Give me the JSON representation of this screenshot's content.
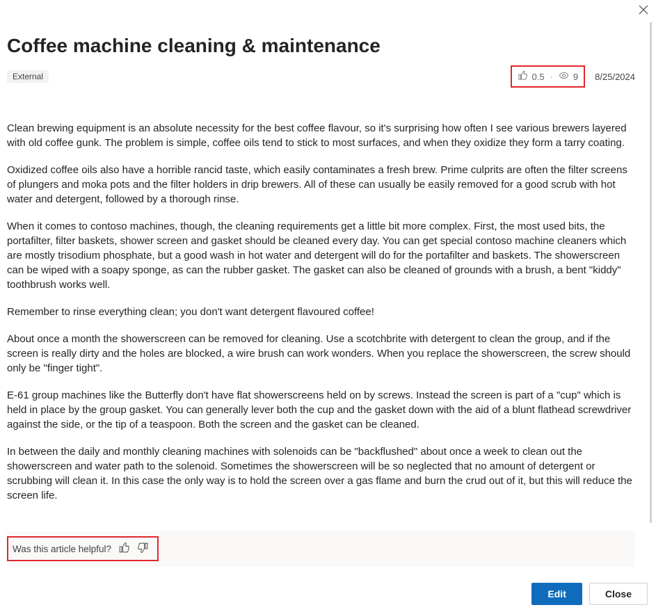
{
  "header": {
    "title": "Coffee machine cleaning & maintenance",
    "tag": "External"
  },
  "stats": {
    "likes": "0.5",
    "views": "9",
    "date": "8/25/2024"
  },
  "body": {
    "paragraphs": [
      "Clean brewing equipment is an absolute necessity for the best coffee flavour, so it's surprising how often I see various brewers layered with old coffee gunk. The problem is simple, coffee oils tend to stick to most surfaces, and when they oxidize they form a tarry coating.",
      "Oxidized coffee oils also have a horrible rancid taste, which easily contaminates a fresh brew. Prime culprits are often the filter screens of plungers and moka pots and the filter holders in drip brewers. All of these can usually be easily removed for a good scrub with hot water and detergent, followed by a thorough rinse.",
      "When it comes to contoso machines, though, the cleaning requirements get a little bit more complex. First, the most used bits, the portafilter, filter baskets, shower screen and gasket should be cleaned every day. You can get special contoso machine cleaners which are mostly trisodium phosphate, but a good wash in hot water and detergent will do for the portafilter and baskets. The showerscreen can be wiped with a soapy sponge, as can the rubber gasket. The gasket can also be cleaned of grounds with a brush, a bent \"kiddy\" toothbrush works well.",
      "Remember to rinse everything clean; you don't want detergent flavoured coffee!",
      "About once a month the showerscreen can be removed for cleaning. Use a scotchbrite with detergent to clean the group, and if the screen is really dirty and the holes are blocked, a wire brush can work wonders. When you replace the showerscreen, the screw should only be \"finger tight\".",
      "E-61 group machines like the Butterfly don't have flat showerscreens held on by screws. Instead the screen is part of a \"cup\" which is held in place by the group gasket. You can generally lever both the cup and the gasket down with the aid of a blunt flathead screwdriver against the side, or the tip of a teaspoon. Both the screen and the gasket can be cleaned.",
      "In between the daily and monthly cleaning machines with solenoids can be \"backflushed\" about once a week to clean out the showerscreen and water path to the solenoid. Sometimes the showerscreen will be so neglected that no amount of detergent or scrubbing will clean it. In this case the only way is to hold the screen over a gas flame and burn the crud out of it, but this will reduce the screen life."
    ]
  },
  "feedback": {
    "prompt": "Was this article helpful?"
  },
  "footer": {
    "edit": "Edit",
    "close": "Close"
  },
  "highlight_color": "#e3262d"
}
